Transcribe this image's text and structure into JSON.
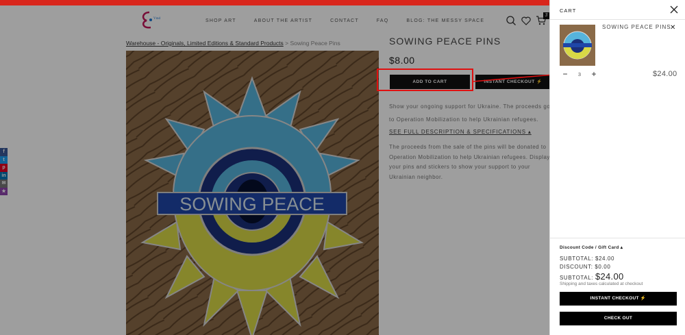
{
  "colors": {
    "topbar": "#d9261c",
    "annotation": "#e01010",
    "button_bg": "#111111",
    "pin_blue": "#56b4dc",
    "pin_yellow": "#d8d846",
    "pin_dark": "#1b2f7a"
  },
  "header": {
    "nav": [
      "SHOP ART",
      "ABOUT THE ARTIST",
      "CONTACT",
      "FAQ",
      "BLOG: THE MESSY SPACE"
    ],
    "icons": [
      "search-icon",
      "heart-icon",
      "cart-icon"
    ],
    "cart_count": "3"
  },
  "breadcrumb": {
    "link": "Warehouse - Originals, Limited Editions & Standard Products",
    "separator": ">",
    "current": "Sowing Peace Pins"
  },
  "product": {
    "title": "SOWING PEACE PINS",
    "price": "$8.00",
    "add_to_cart": "ADD TO CART",
    "instant_checkout": "INSTANT CHECKOUT",
    "short_description": "Show your ongoing support for Ukraine. The proceeds go to Operation Mobilization to help Ukrainian refugees.",
    "see_full": "SEE FULL DESCRIPTION & SPECIFICATIONS",
    "long_description": "The proceeds from the sale of the pins will be donated to Operation Mobilization to help Ukrainian refugees. Display your pins and stickers to show your support to your Ukrainian neighbor.",
    "image_text": "SOWING PEACE"
  },
  "social": [
    "f",
    "t",
    "p",
    "in",
    "✉",
    "★"
  ],
  "cart": {
    "title": "CART",
    "item": {
      "name": "SOWING PEACE PINS",
      "quantity": "3",
      "total": "$24.00"
    },
    "discount_toggle": "Discount Code / Gift Card",
    "subtotal_label": "SUBTOTAL:",
    "subtotal_value": "$24.00",
    "discount_label": "DISCOUNT:",
    "discount_value": "$0.00",
    "grand_label": "SUBTOTAL:",
    "grand_value": "$24.00",
    "shipping_note": "Shipping and taxes calculated at checkout",
    "instant_checkout": "INSTANT CHECKOUT",
    "checkout": "CHECK OUT"
  }
}
